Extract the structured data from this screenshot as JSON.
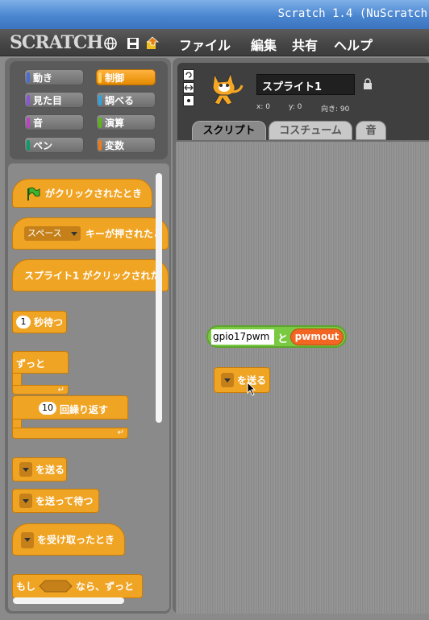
{
  "window": {
    "title": "Scratch 1.4 (NuScratch"
  },
  "menubar": {
    "logo": "SCRATCH",
    "icons": [
      "globe-icon",
      "save-icon",
      "share-icon"
    ],
    "items": [
      "ファイル",
      "編集",
      "共有",
      "ヘルプ"
    ]
  },
  "categories": [
    {
      "label": "動き",
      "color": "#4a6cd4"
    },
    {
      "label": "制御",
      "color": "#e1a91a"
    },
    {
      "label": "見た目",
      "color": "#8a55d7"
    },
    {
      "label": "調べる",
      "color": "#2ca5e2"
    },
    {
      "label": "音",
      "color": "#bb42c3"
    },
    {
      "label": "演算",
      "color": "#5cb712"
    },
    {
      "label": "ペン",
      "color": "#0e9a6c"
    },
    {
      "label": "変数",
      "color": "#ee7d16"
    }
  ],
  "blocks": {
    "green_flag": "がクリックされたとき",
    "key_dropdown": "スペース",
    "key_pressed": "キーが押されたと",
    "sprite_clicked": "スプライト1 がクリックされた",
    "wait_value": "1",
    "wait": "秒待つ",
    "forever": "ずっと",
    "repeat_value": "10",
    "repeat": "回繰り返す",
    "broadcast": "を送る",
    "broadcast_wait": "を送って待つ",
    "when_receive": "を受け取ったとき",
    "if_prefix": "もし",
    "if_suffix": "なら、ずっと"
  },
  "sprite": {
    "name": "スプライト1",
    "x_label": "x: 0",
    "y_label": "y: 0",
    "direction_label": "向き: 90"
  },
  "tabs": [
    "スクリプト",
    "コスチューム",
    "音"
  ],
  "script_area": {
    "join_text": "gpio17pwm",
    "join_word": "と",
    "join_var": "pwmout",
    "broadcast_label": "を送る"
  }
}
